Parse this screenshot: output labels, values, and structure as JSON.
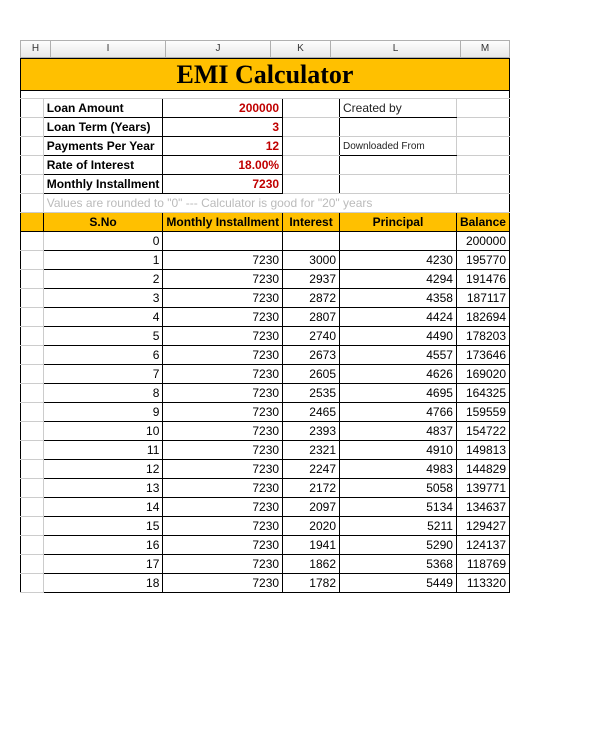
{
  "columns": {
    "H": "H",
    "I": "I",
    "J": "J",
    "K": "K",
    "L": "L",
    "M": "M"
  },
  "title": "EMI Calculator",
  "inputs": {
    "loan_amount_label": "Loan Amount",
    "loan_amount_value": "200000",
    "loan_term_label": "Loan Term (Years)",
    "loan_term_value": "3",
    "payments_per_year_label": "Payments Per Year",
    "payments_per_year_value": "12",
    "rate_label": "Rate of Interest",
    "rate_value": "18.00%",
    "monthly_installment_label": "Monthly Installment",
    "monthly_installment_value": "7230"
  },
  "side": {
    "created_by": "Created by",
    "downloaded_from": "Downloaded From"
  },
  "note": "Values are rounded to \"0\"  ---  Calculator is good for \"20\" years",
  "table": {
    "headers": {
      "sno": "S.No",
      "installment": "Monthly Installment",
      "interest": "Interest",
      "principal": "Principal",
      "balance": "Balance"
    },
    "rows": [
      {
        "sno": "0",
        "installment": "",
        "interest": "",
        "principal": "",
        "balance": "200000"
      },
      {
        "sno": "1",
        "installment": "7230",
        "interest": "3000",
        "principal": "4230",
        "balance": "195770"
      },
      {
        "sno": "2",
        "installment": "7230",
        "interest": "2937",
        "principal": "4294",
        "balance": "191476"
      },
      {
        "sno": "3",
        "installment": "7230",
        "interest": "2872",
        "principal": "4358",
        "balance": "187117"
      },
      {
        "sno": "4",
        "installment": "7230",
        "interest": "2807",
        "principal": "4424",
        "balance": "182694"
      },
      {
        "sno": "5",
        "installment": "7230",
        "interest": "2740",
        "principal": "4490",
        "balance": "178203"
      },
      {
        "sno": "6",
        "installment": "7230",
        "interest": "2673",
        "principal": "4557",
        "balance": "173646"
      },
      {
        "sno": "7",
        "installment": "7230",
        "interest": "2605",
        "principal": "4626",
        "balance": "169020"
      },
      {
        "sno": "8",
        "installment": "7230",
        "interest": "2535",
        "principal": "4695",
        "balance": "164325"
      },
      {
        "sno": "9",
        "installment": "7230",
        "interest": "2465",
        "principal": "4766",
        "balance": "159559"
      },
      {
        "sno": "10",
        "installment": "7230",
        "interest": "2393",
        "principal": "4837",
        "balance": "154722"
      },
      {
        "sno": "11",
        "installment": "7230",
        "interest": "2321",
        "principal": "4910",
        "balance": "149813"
      },
      {
        "sno": "12",
        "installment": "7230",
        "interest": "2247",
        "principal": "4983",
        "balance": "144829"
      },
      {
        "sno": "13",
        "installment": "7230",
        "interest": "2172",
        "principal": "5058",
        "balance": "139771"
      },
      {
        "sno": "14",
        "installment": "7230",
        "interest": "2097",
        "principal": "5134",
        "balance": "134637"
      },
      {
        "sno": "15",
        "installment": "7230",
        "interest": "2020",
        "principal": "5211",
        "balance": "129427"
      },
      {
        "sno": "16",
        "installment": "7230",
        "interest": "1941",
        "principal": "5290",
        "balance": "124137"
      },
      {
        "sno": "17",
        "installment": "7230",
        "interest": "1862",
        "principal": "5368",
        "balance": "118769"
      },
      {
        "sno": "18",
        "installment": "7230",
        "interest": "1782",
        "principal": "5449",
        "balance": "113320"
      }
    ]
  }
}
